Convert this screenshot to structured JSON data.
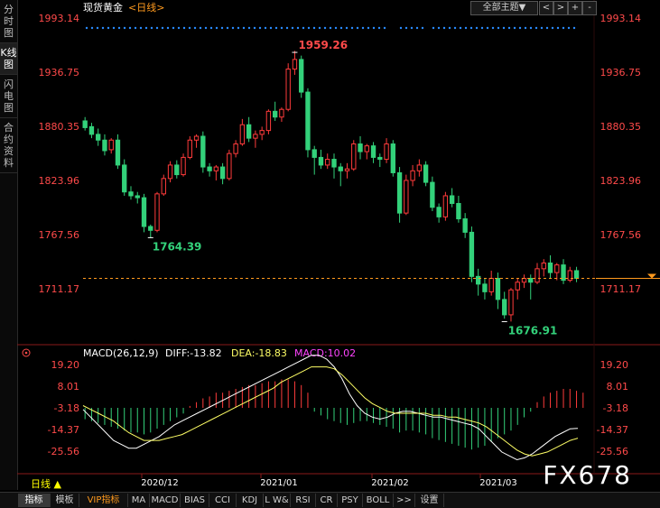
{
  "left_tabs": [
    {
      "label": "分时图"
    },
    {
      "label": "K线图",
      "active": true
    },
    {
      "label": "闪电图"
    },
    {
      "label": "合约资料"
    }
  ],
  "header": {
    "title": "现货黄金",
    "period": "<日线>",
    "theme_button": "全部主题▼"
  },
  "colors": {
    "up": "#ff3b3b",
    "down": "#33d17a",
    "ma": "#ffffff",
    "dea": "#ffff66",
    "macd_label": "#ff44ff",
    "axis": "#ff4a4a",
    "guide": "#ff9a1e",
    "dots": "#2a8cff"
  },
  "price_axis": {
    "ticks": [
      "1993.14",
      "1936.75",
      "1880.35",
      "1823.96",
      "1767.56",
      "1711.17"
    ]
  },
  "annotations": {
    "high": "1959.26",
    "low1": "1764.39",
    "low2": "1676.91"
  },
  "macd": {
    "title": "MACD(26,12,9)",
    "diff": "DIFF:-13.82",
    "dea": "DEA:-18.83",
    "macd": "MACD:10.02",
    "ticks": [
      "19.20",
      "8.01",
      "-3.18",
      "-14.37",
      "-25.56"
    ]
  },
  "date_labels": [
    "2020/12",
    "2021/01",
    "2021/02",
    "2021/03"
  ],
  "period_button": "日线 ▲",
  "watermark": "FX678",
  "bottom_tabs": [
    "指标",
    "模板",
    "VIP指标",
    "MA",
    "MACD",
    "BIAS",
    "CCI",
    "KDJ",
    "L W&",
    "RSI",
    "CR",
    "PSY",
    "BOLL",
    ">>",
    "设置"
  ],
  "chart_data": {
    "type": "candlestick",
    "title": "现货黄金",
    "yrange": [
      1690,
      2000
    ],
    "last_price": 1722,
    "candles": [
      {
        "o": 1886,
        "h": 1890,
        "l": 1876,
        "c": 1879
      },
      {
        "o": 1880,
        "h": 1884,
        "l": 1868,
        "c": 1872
      },
      {
        "o": 1872,
        "h": 1878,
        "l": 1860,
        "c": 1866
      },
      {
        "o": 1866,
        "h": 1872,
        "l": 1850,
        "c": 1855
      },
      {
        "o": 1856,
        "h": 1868,
        "l": 1852,
        "c": 1866
      },
      {
        "o": 1866,
        "h": 1872,
        "l": 1836,
        "c": 1840
      },
      {
        "o": 1840,
        "h": 1846,
        "l": 1808,
        "c": 1812
      },
      {
        "o": 1812,
        "h": 1818,
        "l": 1804,
        "c": 1808
      },
      {
        "o": 1808,
        "h": 1812,
        "l": 1800,
        "c": 1806
      },
      {
        "o": 1806,
        "h": 1810,
        "l": 1770,
        "c": 1776
      },
      {
        "o": 1776,
        "h": 1778,
        "l": 1764,
        "c": 1772
      },
      {
        "o": 1772,
        "h": 1812,
        "l": 1770,
        "c": 1810
      },
      {
        "o": 1810,
        "h": 1830,
        "l": 1808,
        "c": 1826
      },
      {
        "o": 1826,
        "h": 1844,
        "l": 1822,
        "c": 1840
      },
      {
        "o": 1840,
        "h": 1845,
        "l": 1826,
        "c": 1830
      },
      {
        "o": 1830,
        "h": 1852,
        "l": 1828,
        "c": 1848
      },
      {
        "o": 1848,
        "h": 1870,
        "l": 1846,
        "c": 1866
      },
      {
        "o": 1866,
        "h": 1872,
        "l": 1858,
        "c": 1870
      },
      {
        "o": 1870,
        "h": 1875,
        "l": 1832,
        "c": 1838
      },
      {
        "o": 1838,
        "h": 1842,
        "l": 1828,
        "c": 1834
      },
      {
        "o": 1834,
        "h": 1840,
        "l": 1824,
        "c": 1838
      },
      {
        "o": 1838,
        "h": 1842,
        "l": 1820,
        "c": 1826
      },
      {
        "o": 1826,
        "h": 1856,
        "l": 1824,
        "c": 1852
      },
      {
        "o": 1852,
        "h": 1866,
        "l": 1848,
        "c": 1862
      },
      {
        "o": 1862,
        "h": 1888,
        "l": 1860,
        "c": 1882
      },
      {
        "o": 1882,
        "h": 1890,
        "l": 1864,
        "c": 1868
      },
      {
        "o": 1868,
        "h": 1876,
        "l": 1858,
        "c": 1872
      },
      {
        "o": 1872,
        "h": 1880,
        "l": 1866,
        "c": 1876
      },
      {
        "o": 1876,
        "h": 1898,
        "l": 1872,
        "c": 1896
      },
      {
        "o": 1896,
        "h": 1906,
        "l": 1886,
        "c": 1890
      },
      {
        "o": 1890,
        "h": 1900,
        "l": 1885,
        "c": 1898
      },
      {
        "o": 1898,
        "h": 1946,
        "l": 1896,
        "c": 1940
      },
      {
        "o": 1940,
        "h": 1959,
        "l": 1934,
        "c": 1950
      },
      {
        "o": 1950,
        "h": 1954,
        "l": 1910,
        "c": 1916
      },
      {
        "o": 1916,
        "h": 1920,
        "l": 1848,
        "c": 1856
      },
      {
        "o": 1856,
        "h": 1860,
        "l": 1830,
        "c": 1848
      },
      {
        "o": 1848,
        "h": 1856,
        "l": 1836,
        "c": 1840
      },
      {
        "o": 1840,
        "h": 1852,
        "l": 1836,
        "c": 1846
      },
      {
        "o": 1846,
        "h": 1852,
        "l": 1826,
        "c": 1838
      },
      {
        "o": 1838,
        "h": 1842,
        "l": 1818,
        "c": 1834
      },
      {
        "o": 1834,
        "h": 1842,
        "l": 1826,
        "c": 1836
      },
      {
        "o": 1836,
        "h": 1866,
        "l": 1834,
        "c": 1862
      },
      {
        "o": 1862,
        "h": 1870,
        "l": 1846,
        "c": 1854
      },
      {
        "o": 1854,
        "h": 1862,
        "l": 1846,
        "c": 1860
      },
      {
        "o": 1860,
        "h": 1864,
        "l": 1842,
        "c": 1848
      },
      {
        "o": 1848,
        "h": 1852,
        "l": 1838,
        "c": 1846
      },
      {
        "o": 1846,
        "h": 1868,
        "l": 1842,
        "c": 1862
      },
      {
        "o": 1862,
        "h": 1866,
        "l": 1828,
        "c": 1832
      },
      {
        "o": 1832,
        "h": 1838,
        "l": 1780,
        "c": 1790
      },
      {
        "o": 1790,
        "h": 1830,
        "l": 1788,
        "c": 1824
      },
      {
        "o": 1824,
        "h": 1840,
        "l": 1818,
        "c": 1834
      },
      {
        "o": 1834,
        "h": 1846,
        "l": 1828,
        "c": 1840
      },
      {
        "o": 1840,
        "h": 1844,
        "l": 1818,
        "c": 1822
      },
      {
        "o": 1822,
        "h": 1828,
        "l": 1792,
        "c": 1796
      },
      {
        "o": 1796,
        "h": 1800,
        "l": 1780,
        "c": 1786
      },
      {
        "o": 1786,
        "h": 1812,
        "l": 1782,
        "c": 1808
      },
      {
        "o": 1808,
        "h": 1816,
        "l": 1796,
        "c": 1800
      },
      {
        "o": 1800,
        "h": 1808,
        "l": 1780,
        "c": 1784
      },
      {
        "o": 1784,
        "h": 1790,
        "l": 1764,
        "c": 1770
      },
      {
        "o": 1770,
        "h": 1776,
        "l": 1718,
        "c": 1724
      },
      {
        "o": 1724,
        "h": 1732,
        "l": 1704,
        "c": 1716
      },
      {
        "o": 1716,
        "h": 1722,
        "l": 1700,
        "c": 1708
      },
      {
        "o": 1708,
        "h": 1730,
        "l": 1704,
        "c": 1722
      },
      {
        "o": 1722,
        "h": 1728,
        "l": 1690,
        "c": 1700
      },
      {
        "o": 1700,
        "h": 1708,
        "l": 1680,
        "c": 1684
      },
      {
        "o": 1684,
        "h": 1712,
        "l": 1677,
        "c": 1710
      },
      {
        "o": 1710,
        "h": 1722,
        "l": 1700,
        "c": 1718
      },
      {
        "o": 1718,
        "h": 1726,
        "l": 1712,
        "c": 1722
      },
      {
        "o": 1722,
        "h": 1726,
        "l": 1700,
        "c": 1718
      },
      {
        "o": 1718,
        "h": 1738,
        "l": 1716,
        "c": 1732
      },
      {
        "o": 1732,
        "h": 1742,
        "l": 1724,
        "c": 1738
      },
      {
        "o": 1738,
        "h": 1746,
        "l": 1722,
        "c": 1728
      },
      {
        "o": 1728,
        "h": 1738,
        "l": 1720,
        "c": 1736
      },
      {
        "o": 1736,
        "h": 1742,
        "l": 1716,
        "c": 1720
      },
      {
        "o": 1720,
        "h": 1734,
        "l": 1718,
        "c": 1730
      },
      {
        "o": 1730,
        "h": 1734,
        "l": 1718,
        "c": 1722
      }
    ],
    "macd_hist": [
      -6,
      -7,
      -8,
      -9,
      -10,
      -11,
      -12,
      -13,
      -13,
      -14,
      -13,
      -11,
      -9,
      -7,
      -5,
      -3,
      1,
      3,
      5,
      6,
      8,
      8,
      9,
      10,
      11,
      12,
      12,
      13,
      14,
      14,
      15,
      15,
      14,
      12,
      8,
      -2,
      -4,
      -6,
      -7,
      -8,
      -9,
      -8,
      -7,
      -7,
      -8,
      -9,
      -10,
      -11,
      -13,
      -12,
      -12,
      -13,
      -14,
      -16,
      -17,
      -18,
      -19,
      -20,
      -21,
      -22,
      -21,
      -20,
      -18,
      -16,
      -14,
      -12,
      -9,
      -5,
      -2,
      3,
      6,
      8,
      9,
      10,
      10,
      9,
      8
    ],
    "diff": [
      -4,
      -8,
      -12,
      -16,
      -20,
      -22,
      -24,
      -24,
      -22,
      -20,
      -18,
      -15,
      -12,
      -10,
      -8,
      -6,
      -4,
      -2,
      0,
      2,
      4,
      6,
      8,
      10,
      12,
      14,
      16,
      18,
      20,
      22,
      24,
      24,
      22,
      18,
      12,
      4,
      -2,
      -6,
      -8,
      -9,
      -8,
      -6,
      -5,
      -5,
      -6,
      -7,
      -8,
      -8,
      -9,
      -10,
      -11,
      -12,
      -14,
      -18,
      -22,
      -26,
      -28,
      -30,
      -29,
      -27,
      -24,
      -21,
      -18,
      -16,
      -14,
      -13.82
    ],
    "dea": [
      -2,
      -4,
      -6,
      -8,
      -10,
      -13,
      -16,
      -18,
      -20,
      -20,
      -20,
      -19,
      -18,
      -17,
      -15,
      -13,
      -11,
      -9,
      -7,
      -5,
      -3,
      -1,
      1,
      3,
      5,
      7,
      10,
      12,
      14,
      16,
      18,
      18,
      18,
      17,
      14,
      10,
      6,
      2,
      -1,
      -3,
      -5,
      -6,
      -6,
      -6,
      -6,
      -6,
      -7,
      -7,
      -8,
      -8,
      -9,
      -10,
      -11,
      -13,
      -16,
      -19,
      -22,
      -25,
      -27,
      -28,
      -27,
      -26,
      -24,
      -22,
      -20,
      -18.83
    ]
  }
}
